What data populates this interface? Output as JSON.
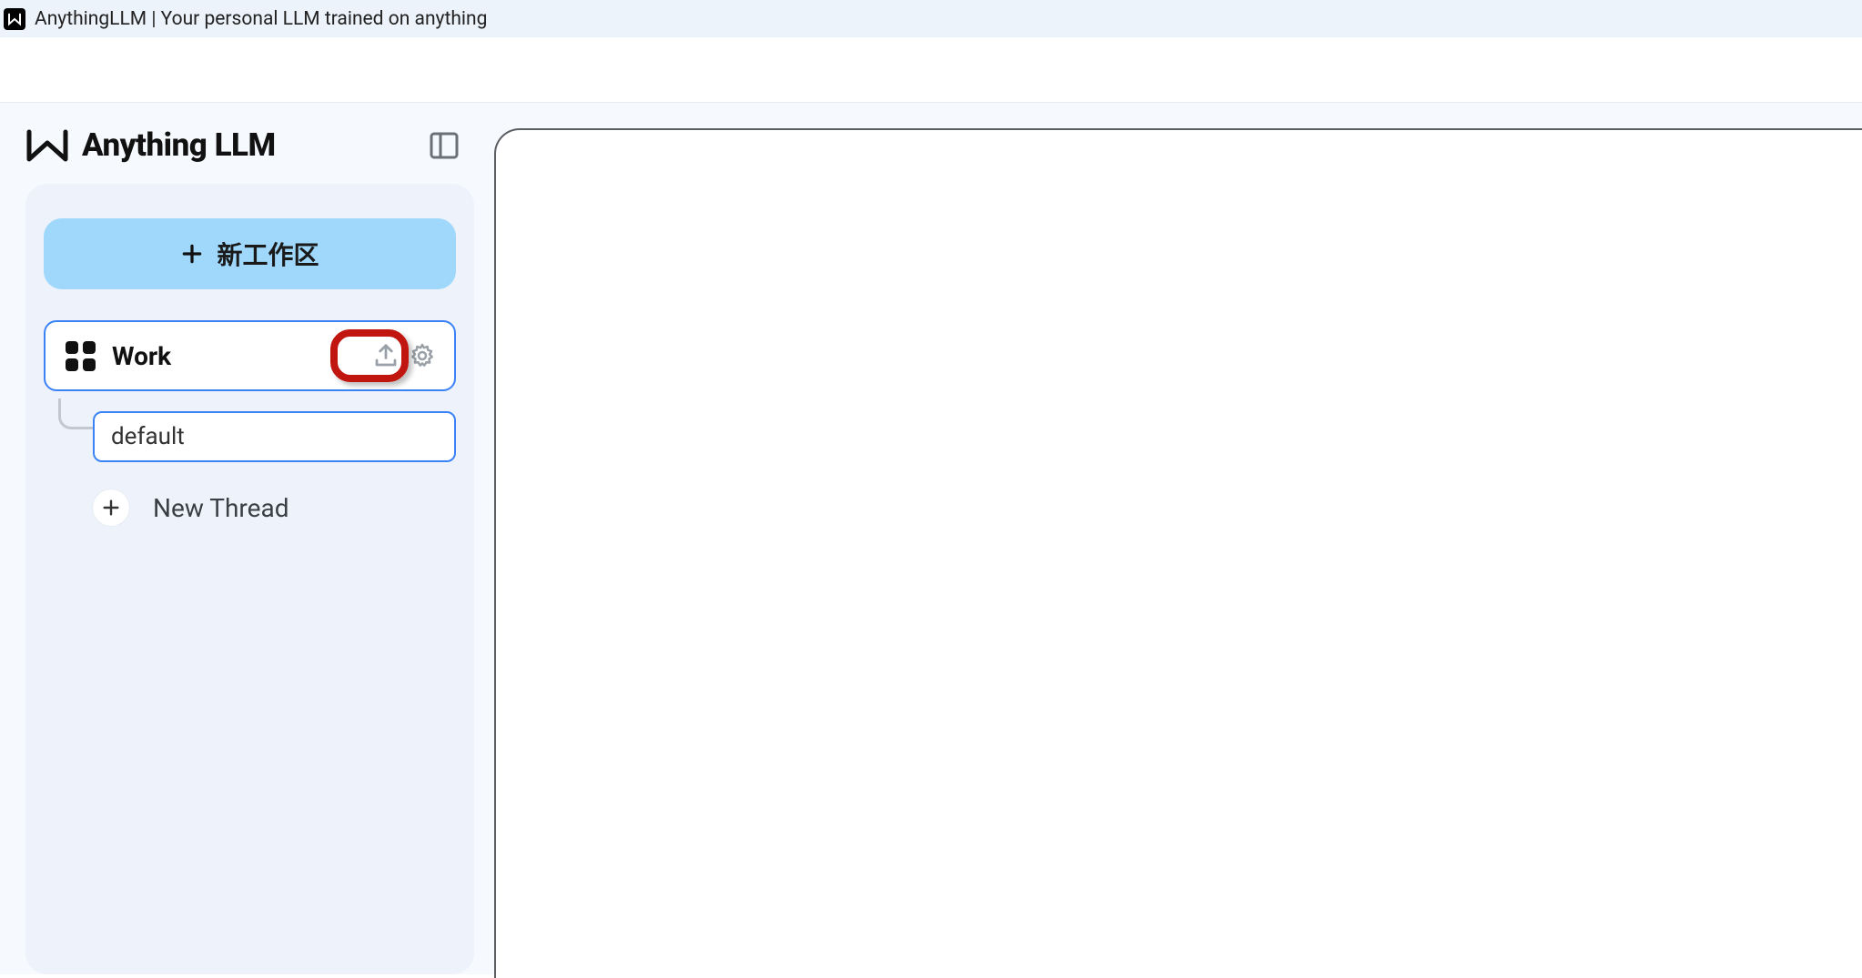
{
  "window": {
    "title": "AnythingLLM | Your personal LLM trained on anything"
  },
  "brand": {
    "name": "Anything LLM"
  },
  "sidebar": {
    "new_workspace_label": "新工作区",
    "workspace": {
      "name": "Work",
      "upload_icon": "upload-icon",
      "settings_icon": "gear-icon"
    },
    "threads": [
      {
        "label": "default"
      }
    ],
    "new_thread_label": "New Thread"
  }
}
